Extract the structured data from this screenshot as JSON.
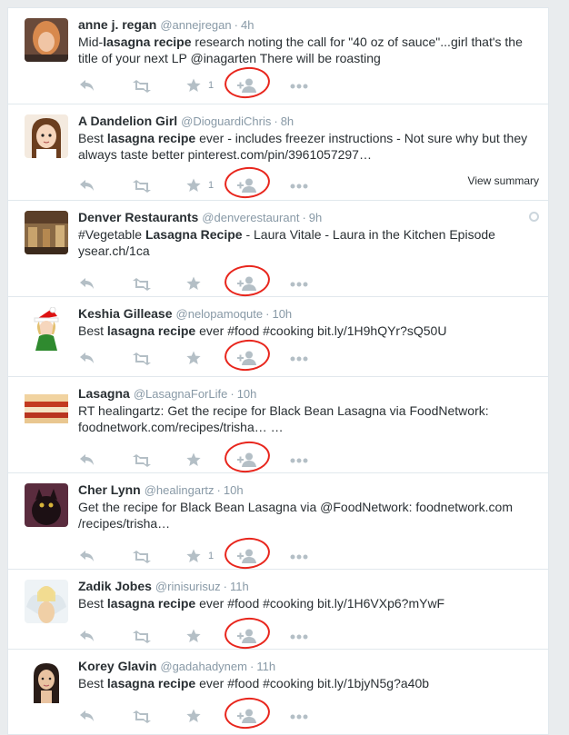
{
  "tweets": [
    {
      "name": "anne j. regan",
      "handle": "@annejregan",
      "time": "4h",
      "body_html": "Mid-<b>lasagna recipe</b> research noting the call for \"40 oz of sauce\"...girl that's the title of your next LP @inagarten There will be roasting",
      "favorites": "1"
    },
    {
      "name": "A Dandelion Girl",
      "handle": "@DioguardiChris",
      "time": "8h",
      "body_html": "Best <b>lasagna recipe</b> ever - includes freezer instructions - Not sure why but they always taste better pinterest.com/pin/3961057297…",
      "favorites": "1",
      "view_summary": "View summary"
    },
    {
      "name": "Denver Restaurants",
      "handle": "@denverestaurant",
      "time": "9h",
      "body_html": "#Vegetable <b>Lasagna Recipe</b> - Laura Vitale - Laura in the Kitchen Episode ysear.ch/1ca",
      "favorites": ""
    },
    {
      "name": "Keshia Gillease",
      "handle": "@nelopamoqute",
      "time": "10h",
      "body_html": "Best <b>lasagna recipe</b> ever #food #cooking bit.ly/1H9hQYr?sQ50U",
      "favorites": ""
    },
    {
      "name": "Lasagna",
      "handle": "@LasagnaForLife",
      "time": "10h",
      "body_html": "RT healingartz: Get the recipe for Black Bean Lasagna via FoodNetwork: foodnetwork.com/recipes/trisha… …",
      "favorites": ""
    },
    {
      "name": "Cher Lynn",
      "handle": "@healingartz",
      "time": "10h",
      "body_html": "Get the recipe for Black Bean Lasagna via @FoodNetwork:  foodnetwork.com /recipes/trisha…",
      "favorites": "1"
    },
    {
      "name": "Zadik Jobes",
      "handle": "@rinisurisuz",
      "time": "11h",
      "body_html": "Best <b>lasagna recipe</b> ever #food #cooking bit.ly/1H6VXp6?mYwF",
      "favorites": ""
    },
    {
      "name": "Korey Glavin",
      "handle": "@gadahadynem",
      "time": "11h",
      "body_html": "Best <b>lasagna recipe</b> ever #food #cooking bit.ly/1bjyN5g?a40b",
      "favorites": ""
    }
  ],
  "colors": {
    "action_icon": "#b4bfc6",
    "annotation_circle": "#e8261d",
    "muted_text": "#8899a6"
  },
  "icons": [
    "reply-icon",
    "retweet-icon",
    "favorite-star-icon",
    "follow-user-icon",
    "more-ellipsis-icon",
    "geo-location-icon"
  ]
}
